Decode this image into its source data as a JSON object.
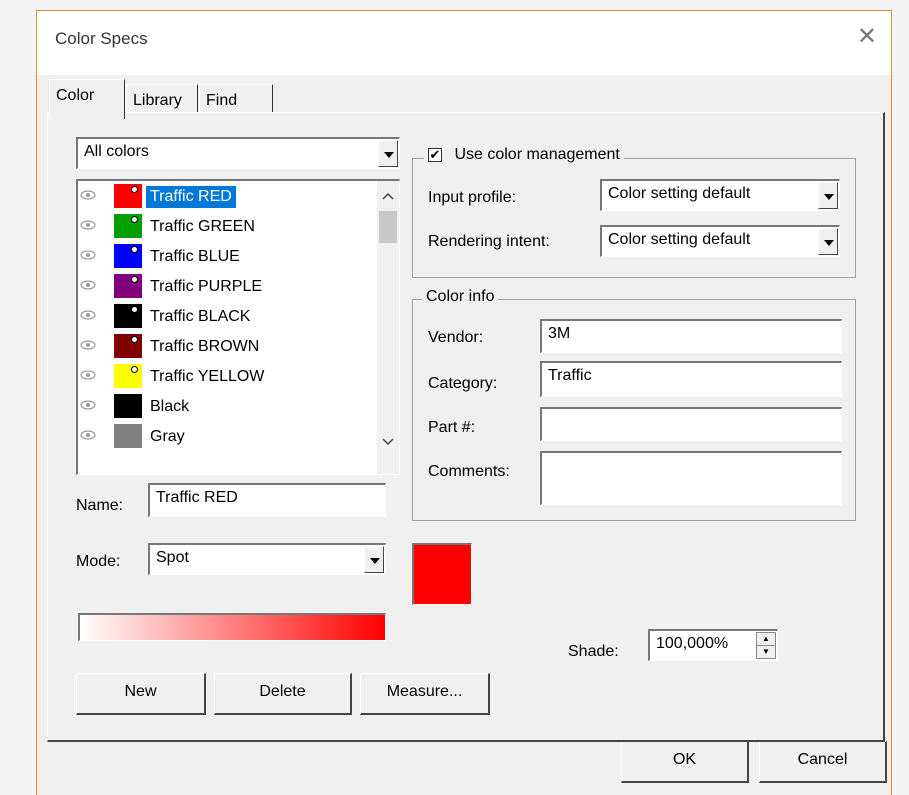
{
  "window": {
    "title": "Color Specs",
    "close_glyph": "✕"
  },
  "tabs": [
    {
      "label": "Color"
    },
    {
      "label": "Library"
    },
    {
      "label": "Find"
    }
  ],
  "filter": {
    "selected": "All colors"
  },
  "color_list": {
    "items": [
      {
        "label": "Traffic RED",
        "color": "#ff0000",
        "spot": true,
        "selected": true
      },
      {
        "label": "Traffic GREEN",
        "color": "#00a000",
        "spot": true
      },
      {
        "label": "Traffic BLUE",
        "color": "#0000ff",
        "spot": true
      },
      {
        "label": "Traffic PURPLE",
        "color": "#800080",
        "spot": true
      },
      {
        "label": "Traffic BLACK",
        "color": "#000000",
        "spot": true
      },
      {
        "label": "Traffic BROWN",
        "color": "#800000",
        "spot": true
      },
      {
        "label": "Traffic YELLOW",
        "color": "#ffff00",
        "spot": true
      },
      {
        "label": "Black",
        "color": "#000000",
        "spot": false
      },
      {
        "label": "Gray",
        "color": "#808080",
        "spot": false
      }
    ]
  },
  "name_field": {
    "label": "Name:",
    "value": "Traffic RED"
  },
  "mode_field": {
    "label": "Mode:",
    "value": "Spot"
  },
  "preview": {
    "color": "#ff0000"
  },
  "color_management": {
    "checkbox_label": "Use color management",
    "checked": true,
    "input_profile": {
      "label": "Input profile:",
      "value": "Color setting default"
    },
    "rendering_intent": {
      "label": "Rendering intent:",
      "value": "Color setting default"
    }
  },
  "color_info": {
    "title": "Color info",
    "vendor": {
      "label": "Vendor:",
      "value": "3M"
    },
    "category": {
      "label": "Category:",
      "value": "Traffic"
    },
    "part": {
      "label": "Part #:",
      "value": ""
    },
    "comments": {
      "label": "Comments:",
      "value": ""
    }
  },
  "shade": {
    "label": "Shade:",
    "value": "100,000%"
  },
  "buttons": {
    "new": "New",
    "delete": "Delete",
    "measure": "Measure...",
    "ok": "OK",
    "cancel": "Cancel"
  }
}
